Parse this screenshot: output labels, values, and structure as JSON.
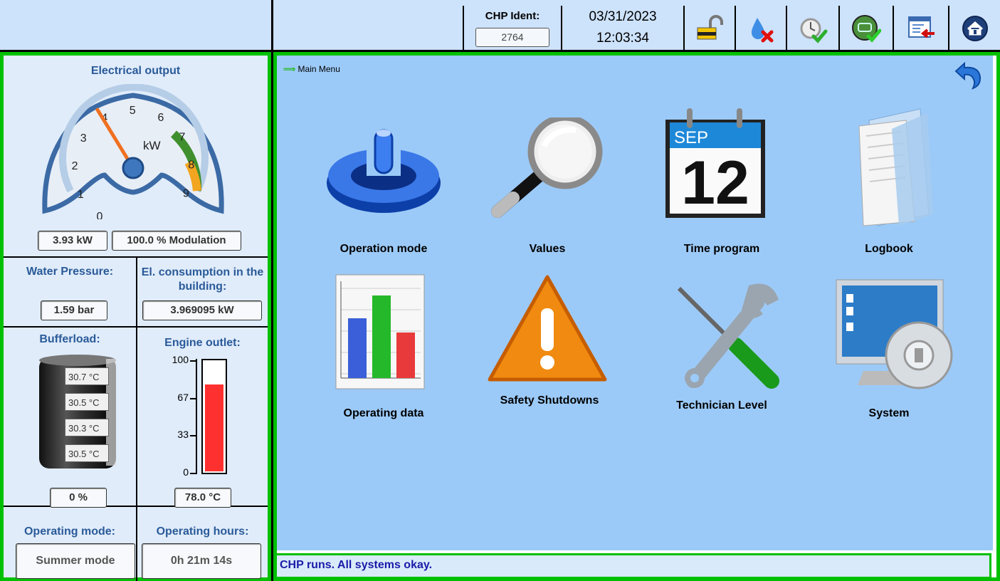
{
  "header": {
    "chp_ident_label": "CHP Ident:",
    "chp_ident_value": "2764",
    "date": "03/31/2023",
    "time": "12:03:34",
    "icons": [
      "unlock-icon",
      "gas-error-icon",
      "alarm-clock-check-icon",
      "chp-ok-icon",
      "logout-window-icon",
      "home-icon"
    ]
  },
  "left": {
    "electrical_output": {
      "title": "Electrical output",
      "gauge_unit": "kW",
      "gauge_ticks": [
        "0",
        "1",
        "2",
        "3",
        "4",
        "5",
        "6",
        "7",
        "8",
        "9"
      ],
      "gauge_value": 3.93,
      "gauge_max": 9,
      "value_text": "3.93 kW",
      "modulation_text": "100.0 % Modulation"
    },
    "water_pressure": {
      "title": "Water Pressure:",
      "value": "1.59 bar"
    },
    "el_consumption": {
      "title": "El. consumption in the building:",
      "value": "3.969095 kW"
    },
    "bufferload": {
      "title": "Bufferload:",
      "temps": [
        "30.7 °C",
        "30.5 °C",
        "30.3 °C",
        "30.5 °C"
      ],
      "percent": "0 %"
    },
    "engine_outlet": {
      "title": "Engine outlet:",
      "scale": [
        "100",
        "67",
        "33",
        "0"
      ],
      "fill_fraction": 0.78,
      "value": "78.0 °C"
    },
    "operating_mode": {
      "title": "Operating mode:",
      "value": "Summer mode"
    },
    "operating_hours": {
      "title": "Operating hours:",
      "value": "0h 21m 14s"
    }
  },
  "main": {
    "breadcrumb": "Main Menu",
    "tiles": [
      {
        "label": "Operation mode",
        "icon": "power-button-icon"
      },
      {
        "label": "Values",
        "icon": "magnifier-icon"
      },
      {
        "label": "Time program",
        "icon": "calendar-icon",
        "cal_month": "SEP",
        "cal_day": "12"
      },
      {
        "label": "Logbook",
        "icon": "folder-documents-icon"
      },
      {
        "label": "Operating data",
        "icon": "bar-chart-icon"
      },
      {
        "label": "Safety Shutdowns",
        "icon": "warning-icon"
      },
      {
        "label": "Technician Level",
        "icon": "tools-icon"
      },
      {
        "label": "System",
        "icon": "system-settings-icon"
      }
    ]
  },
  "status": {
    "text": "CHP runs. All systems okay."
  },
  "colors": {
    "accent_green": "#00c000",
    "panel_blue": "#9ccaf8",
    "title_blue": "#2a5a99",
    "bar_red": "#ff3030"
  }
}
